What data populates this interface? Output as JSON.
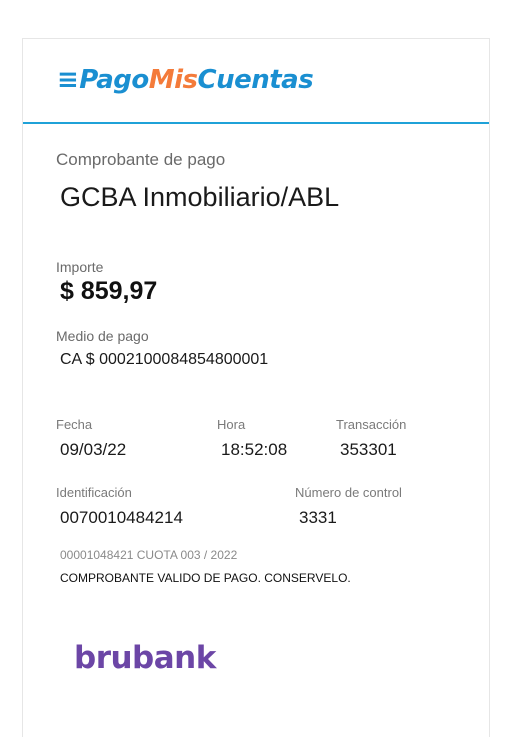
{
  "header": {
    "logo_part1": "PagoMis",
    "logo_part1a": "Pago",
    "logo_part2": "Mis",
    "logo_part3": "Cuentas",
    "logo_icon": "three-dash-icon"
  },
  "receipt": {
    "heading": "Comprobante de pago",
    "service": "GCBA Inmobiliario/ABL",
    "amount_label": "Importe",
    "amount": "$ 859,97",
    "payment_method_label": "Medio de pago",
    "payment_method": "CA $ 0002100084854800001",
    "date_label": "Fecha",
    "date": "09/03/22",
    "time_label": "Hora",
    "time": "18:52:08",
    "transaction_label": "Transacción",
    "transaction": "353301",
    "id_label": "Identificación",
    "id": "0070010484214",
    "control_label": "Número de control",
    "control": "3331",
    "detail_line": "00001048421 CUOTA 003 / 2022",
    "validity_note": "COMPROBANTE VALIDO DE PAGO. CONSERVELO."
  },
  "footer": {
    "brand": "brubank"
  },
  "colors": {
    "brand_blue": "#1a8fd1",
    "brand_orange": "#f47b3a",
    "divider_blue": "#1fa2d8",
    "brubank_purple": "#6c46a6"
  }
}
